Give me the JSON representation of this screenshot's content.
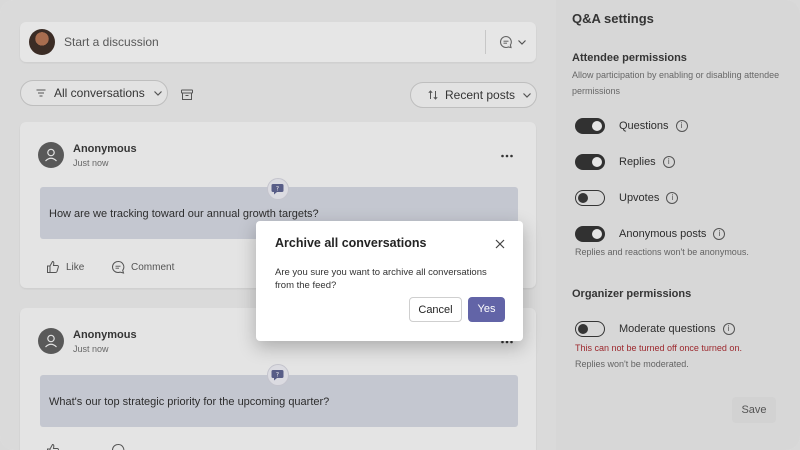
{
  "compose": {
    "placeholder": "Start a discussion"
  },
  "toolbar": {
    "filter_label": "All conversations",
    "sort_label": "Recent posts"
  },
  "posts": [
    {
      "author": "Anonymous",
      "time": "Just now",
      "question": "How are we tracking toward our annual growth targets?",
      "like_label": "Like",
      "comment_label": "Comment"
    },
    {
      "author": "Anonymous",
      "time": "Just now",
      "question": "What's our top strategic priority for the upcoming quarter?"
    }
  ],
  "settings": {
    "title": "Q&A settings",
    "attendee": {
      "title": "Attendee permissions",
      "description": "Allow participation by enabling or disabling attendee permissions",
      "items": [
        {
          "label": "Questions",
          "enabled": true
        },
        {
          "label": "Replies",
          "enabled": true
        },
        {
          "label": "Upvotes",
          "enabled": false
        },
        {
          "label": "Anonymous posts",
          "enabled": true,
          "note": "Replies and reactions won't be anonymous."
        }
      ]
    },
    "organizer": {
      "title": "Organizer permissions",
      "items": [
        {
          "label": "Moderate questions",
          "enabled": false,
          "warning": "This can not be turned off once turned on.",
          "note": "Replies won't be moderated."
        }
      ]
    },
    "save_label": "Save"
  },
  "dialog": {
    "title": "Archive all conversations",
    "body": "Are you sure you want to archive all conversations from the feed?",
    "cancel_label": "Cancel",
    "confirm_label": "Yes"
  },
  "colors": {
    "accent": "#6264a7",
    "warning": "#a4262c",
    "question_bg": "#cfd2dc"
  }
}
